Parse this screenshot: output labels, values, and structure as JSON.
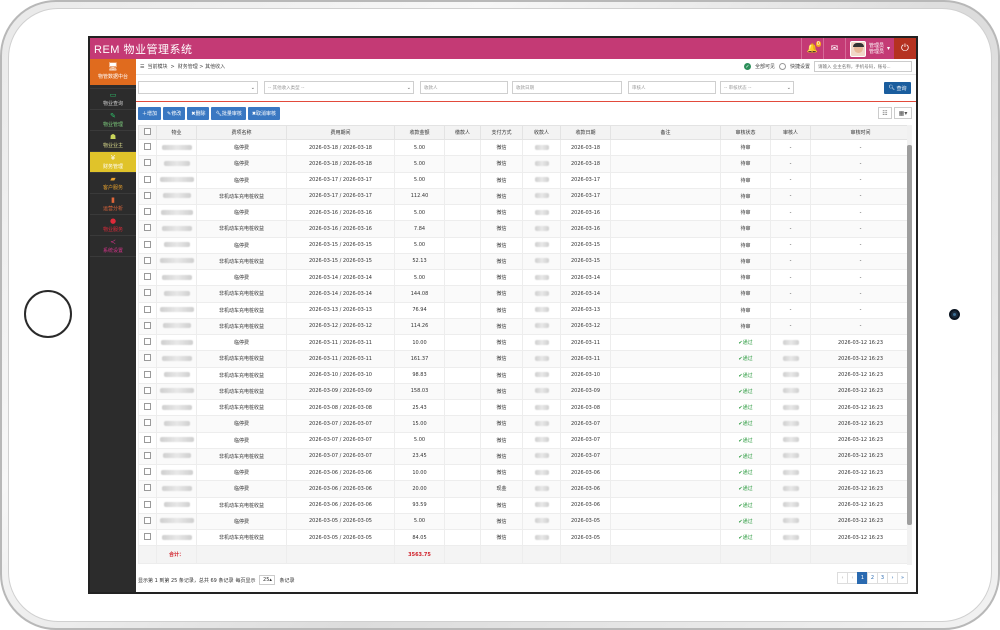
{
  "app": {
    "title": "REM 物业管理系统"
  },
  "topbar": {
    "bell_badge": "0",
    "user_line1": "管理员",
    "user_line2": "管理员"
  },
  "sidebar": {
    "header": "物管数据中台",
    "items": [
      {
        "label": "物业查询",
        "icon": "monitor-icon",
        "active": false
      },
      {
        "label": "物业管理",
        "icon": "edit-icon",
        "active": false
      },
      {
        "label": "物业业主",
        "icon": "users-icon",
        "active": false
      },
      {
        "label": "财务管理",
        "icon": "yen-icon",
        "active": true
      },
      {
        "label": "客户服务",
        "icon": "service-icon",
        "active": false
      },
      {
        "label": "运营分析",
        "icon": "bar-chart-icon",
        "active": false
      },
      {
        "label": "物业服务",
        "icon": "chat-icon",
        "active": false
      },
      {
        "label": "系统设置",
        "icon": "share-icon",
        "active": false
      }
    ]
  },
  "breadcrumb": {
    "prefix": "当前模块",
    "sep": ">",
    "path": "财务管理 > 其他收入"
  },
  "nav_right": {
    "option1": "全部可见",
    "option2": "快捷设置",
    "search_placeholder": "请输入 业主名称，手机号码，账号..."
  },
  "filters": {
    "select1": "",
    "select2": "-- 其他收入类型 --",
    "input1": "收款人",
    "input2": "收款日期",
    "input3": "审核人",
    "select3": "-- 审核状态 --",
    "query_label": "查询"
  },
  "toolbar": [
    "增加",
    "修改",
    "删除",
    "批量审核",
    "取消审核"
  ],
  "table": {
    "headers": [
      "",
      "物业",
      "费项名称",
      "费用期间",
      "收款金额",
      "缴款人",
      "支付方式",
      "收款人",
      "收款日期",
      "备注",
      "审核状态",
      "审核人",
      "审核时间"
    ],
    "rows": [
      {
        "fee": "临停费",
        "period": "2026-03-18 / 2026-03-18",
        "amount": "5.00",
        "pay": "微信",
        "date": "2026-03-18",
        "status": "待审",
        "auditor": "-",
        "time": "-"
      },
      {
        "fee": "临停费",
        "period": "2026-03-18 / 2026-03-18",
        "amount": "5.00",
        "pay": "微信",
        "date": "2026-03-18",
        "status": "待审",
        "auditor": "-",
        "time": "-"
      },
      {
        "fee": "临停费",
        "period": "2026-03-17 / 2026-03-17",
        "amount": "5.00",
        "pay": "微信",
        "date": "2026-03-17",
        "status": "待审",
        "auditor": "-",
        "time": "-"
      },
      {
        "fee": "非机动车充电桩收益",
        "period": "2026-03-17 / 2026-03-17",
        "amount": "112.40",
        "pay": "微信",
        "date": "2026-03-17",
        "status": "待审",
        "auditor": "-",
        "time": "-"
      },
      {
        "fee": "临停费",
        "period": "2026-03-16 / 2026-03-16",
        "amount": "5.00",
        "pay": "微信",
        "date": "2026-03-16",
        "status": "待审",
        "auditor": "-",
        "time": "-"
      },
      {
        "fee": "非机动车充电桩收益",
        "period": "2026-03-16 / 2026-03-16",
        "amount": "7.84",
        "pay": "微信",
        "date": "2026-03-16",
        "status": "待审",
        "auditor": "-",
        "time": "-"
      },
      {
        "fee": "临停费",
        "period": "2026-03-15 / 2026-03-15",
        "amount": "5.00",
        "pay": "微信",
        "date": "2026-03-15",
        "status": "待审",
        "auditor": "-",
        "time": "-"
      },
      {
        "fee": "非机动车充电桩收益",
        "period": "2026-03-15 / 2026-03-15",
        "amount": "52.13",
        "pay": "微信",
        "date": "2026-03-15",
        "status": "待审",
        "auditor": "-",
        "time": "-"
      },
      {
        "fee": "临停费",
        "period": "2026-03-14 / 2026-03-14",
        "amount": "5.00",
        "pay": "微信",
        "date": "2026-03-14",
        "status": "待审",
        "auditor": "-",
        "time": "-"
      },
      {
        "fee": "非机动车充电桩收益",
        "period": "2026-03-14 / 2026-03-14",
        "amount": "144.08",
        "pay": "微信",
        "date": "2026-03-14",
        "status": "待审",
        "auditor": "-",
        "time": "-"
      },
      {
        "fee": "非机动车充电桩收益",
        "period": "2026-03-13 / 2026-03-13",
        "amount": "76.94",
        "pay": "微信",
        "date": "2026-03-13",
        "status": "待审",
        "auditor": "-",
        "time": "-"
      },
      {
        "fee": "非机动车充电桩收益",
        "period": "2026-03-12 / 2026-03-12",
        "amount": "114.26",
        "pay": "微信",
        "date": "2026-03-12",
        "status": "待审",
        "auditor": "-",
        "time": "-"
      },
      {
        "fee": "临停费",
        "period": "2026-03-11 / 2026-03-11",
        "amount": "10.00",
        "pay": "微信",
        "date": "2026-03-11",
        "status": "通过",
        "auditor": "",
        "time": "2026-03-12 16:23"
      },
      {
        "fee": "非机动车充电桩收益",
        "period": "2026-03-11 / 2026-03-11",
        "amount": "161.37",
        "pay": "微信",
        "date": "2026-03-11",
        "status": "通过",
        "auditor": "",
        "time": "2026-03-12 16:23"
      },
      {
        "fee": "非机动车充电桩收益",
        "period": "2026-03-10 / 2026-03-10",
        "amount": "98.83",
        "pay": "微信",
        "date": "2026-03-10",
        "status": "通过",
        "auditor": "",
        "time": "2026-03-12 16:23"
      },
      {
        "fee": "非机动车充电桩收益",
        "period": "2026-03-09 / 2026-03-09",
        "amount": "158.03",
        "pay": "微信",
        "date": "2026-03-09",
        "status": "通过",
        "auditor": "",
        "time": "2026-03-12 16:23"
      },
      {
        "fee": "非机动车充电桩收益",
        "period": "2026-03-08 / 2026-03-08",
        "amount": "25.43",
        "pay": "微信",
        "date": "2026-03-08",
        "status": "通过",
        "auditor": "",
        "time": "2026-03-12 16:23"
      },
      {
        "fee": "临停费",
        "period": "2026-03-07 / 2026-03-07",
        "amount": "15.00",
        "pay": "微信",
        "date": "2026-03-07",
        "status": "通过",
        "auditor": "",
        "time": "2026-03-12 16:23"
      },
      {
        "fee": "临停费",
        "period": "2026-03-07 / 2026-03-07",
        "amount": "5.00",
        "pay": "微信",
        "date": "2026-03-07",
        "status": "通过",
        "auditor": "",
        "time": "2026-03-12 16:23"
      },
      {
        "fee": "非机动车充电桩收益",
        "period": "2026-03-07 / 2026-03-07",
        "amount": "23.45",
        "pay": "微信",
        "date": "2026-03-07",
        "status": "通过",
        "auditor": "",
        "time": "2026-03-12 16:23"
      },
      {
        "fee": "临停费",
        "period": "2026-03-06 / 2026-03-06",
        "amount": "10.00",
        "pay": "微信",
        "date": "2026-03-06",
        "status": "通过",
        "auditor": "",
        "time": "2026-03-12 16:23"
      },
      {
        "fee": "临停费",
        "period": "2026-03-06 / 2026-03-06",
        "amount": "20.00",
        "pay": "现金",
        "date": "2026-03-06",
        "status": "通过",
        "auditor": "",
        "time": "2026-03-12 16:23"
      },
      {
        "fee": "非机动车充电桩收益",
        "period": "2026-03-06 / 2026-03-06",
        "amount": "93.59",
        "pay": "微信",
        "date": "2026-03-06",
        "status": "通过",
        "auditor": "",
        "time": "2026-03-12 16:23"
      },
      {
        "fee": "临停费",
        "period": "2026-03-05 / 2026-03-05",
        "amount": "5.00",
        "pay": "微信",
        "date": "2026-03-05",
        "status": "通过",
        "auditor": "",
        "time": "2026-03-12 16:23"
      },
      {
        "fee": "非机动车充电桩收益",
        "period": "2026-03-05 / 2026-03-05",
        "amount": "84.05",
        "pay": "微信",
        "date": "2026-03-05",
        "status": "通过",
        "auditor": "",
        "time": "2026-03-12 16:23"
      }
    ],
    "total_label": "合计：",
    "total_amount": "3563.75"
  },
  "footer": {
    "summary": "显示第 1 到第 25 条记录，总共 69 条记录",
    "per_page_prefix": "每页显示",
    "per_page": "25",
    "per_page_suffix": "条记录",
    "pages": [
      "‹",
      "‹",
      "1",
      "2",
      "3",
      "›",
      "»"
    ],
    "current_page": "1"
  },
  "colors": {
    "topbar": "#c43a75",
    "sidebar": "#2c2c2c",
    "active": "#e0c32a",
    "primary": "#3a78c2",
    "approved": "#2a9a3e",
    "total": "#d0202a"
  }
}
